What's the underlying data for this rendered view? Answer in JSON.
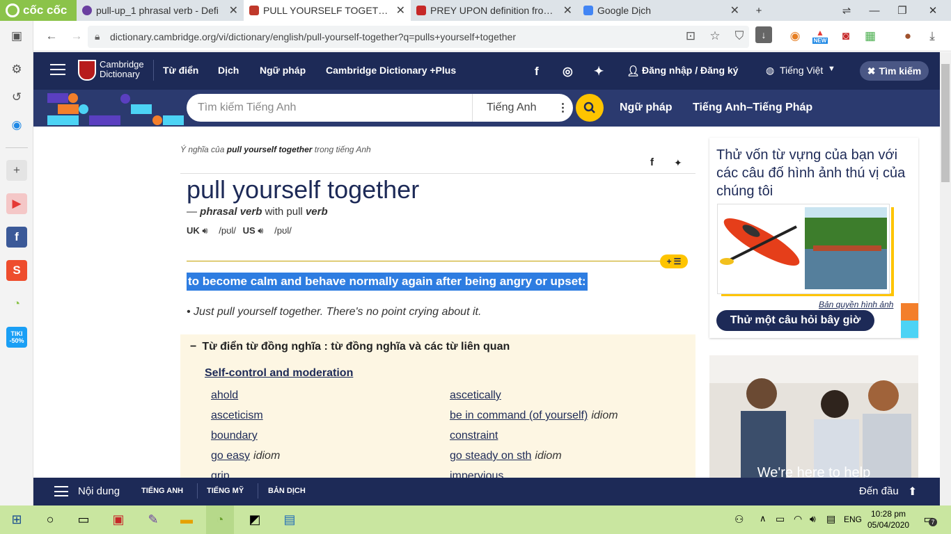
{
  "browser": {
    "brand": "cốc cốc",
    "tabs": [
      {
        "title": "pull-up_1 phrasal verb - Defi",
        "color": "#6a3fa0"
      },
      {
        "title": "PULL YOURSELF TOGETHER | C",
        "color": "#c0392b"
      },
      {
        "title": "PREY UPON definition from M",
        "color": "#c62828"
      },
      {
        "title": "Google Dịch",
        "color": "#4285f4"
      }
    ],
    "url": "dictionary.cambridge.org/vi/dictionary/english/pull-yourself-together?q=pulls+yourself+together",
    "badge_new": "NEW"
  },
  "site": {
    "logo_line1": "Cambridge",
    "logo_line2": "Dictionary",
    "nav": [
      "Từ điển",
      "Dịch",
      "Ngữ pháp",
      "Cambridge Dictionary +Plus"
    ],
    "login": "Đăng nhập / Đăng ký",
    "language": "Tiếng Việt",
    "search_toggle": "Tìm kiếm",
    "search_placeholder": "Tìm kiếm Tiếng Anh",
    "search_lang": "Tiếng Anh",
    "sublinks": [
      "Ngữ pháp",
      "Tiếng Anh–Tiếng Pháp"
    ]
  },
  "entry": {
    "meaning_prefix": "Ý nghĩa của",
    "meaning_word": "pull yourself together",
    "meaning_suffix": "trong tiếng Anh",
    "headword": "pull yourself together",
    "pos_dash": "—",
    "pos": "phrasal verb",
    "pos_with": "with pull",
    "pos_verb": "verb",
    "uk_label": "UK",
    "uk_ipa": "/pʊl/",
    "us_label": "US",
    "us_ipa": "/pʊl/",
    "plus_label": "+",
    "definition": "to become calm and behave normally again after being angry or upset:",
    "example": "Just pull yourself together. There's no point crying about it."
  },
  "thesaurus": {
    "title": "Từ điển từ đồng nghĩa : từ đồng nghĩa và các từ liên quan",
    "subtitle": "Self-control and moderation",
    "left": [
      {
        "word": "ahold",
        "note": ""
      },
      {
        "word": "asceticism",
        "note": ""
      },
      {
        "word": "boundary",
        "note": ""
      },
      {
        "word": "go easy",
        "note": "idiom"
      },
      {
        "word": "grip",
        "note": ""
      }
    ],
    "right": [
      {
        "word": "ascetically",
        "note": ""
      },
      {
        "word": "be in command (of yourself)",
        "note": "idiom"
      },
      {
        "word": "constraint",
        "note": ""
      },
      {
        "word": "go steady on sth",
        "note": "idiom"
      },
      {
        "word": "impervious",
        "note": ""
      }
    ]
  },
  "sidebar": {
    "quiz_text": "Thử vốn từ vựng của bạn với các câu đố hình ảnh thú vị của chúng tôi",
    "copyright": "Bản quyền hình ảnh",
    "quiz_button": "Thử một câu hỏi bây giờ",
    "ad_text": "We're here to help"
  },
  "bottom": {
    "menu": "Nội dung",
    "tabs": [
      "TIẾNG ANH",
      "TIẾNG MỸ",
      "BẢN DỊCH"
    ],
    "top": "Đến đầu"
  },
  "taskbar": {
    "lang": "ENG",
    "time": "10:28 pm",
    "date": "05/04/2020",
    "notif": "7",
    "tiki": "TIKI",
    "tiki_sale": "-50%"
  }
}
